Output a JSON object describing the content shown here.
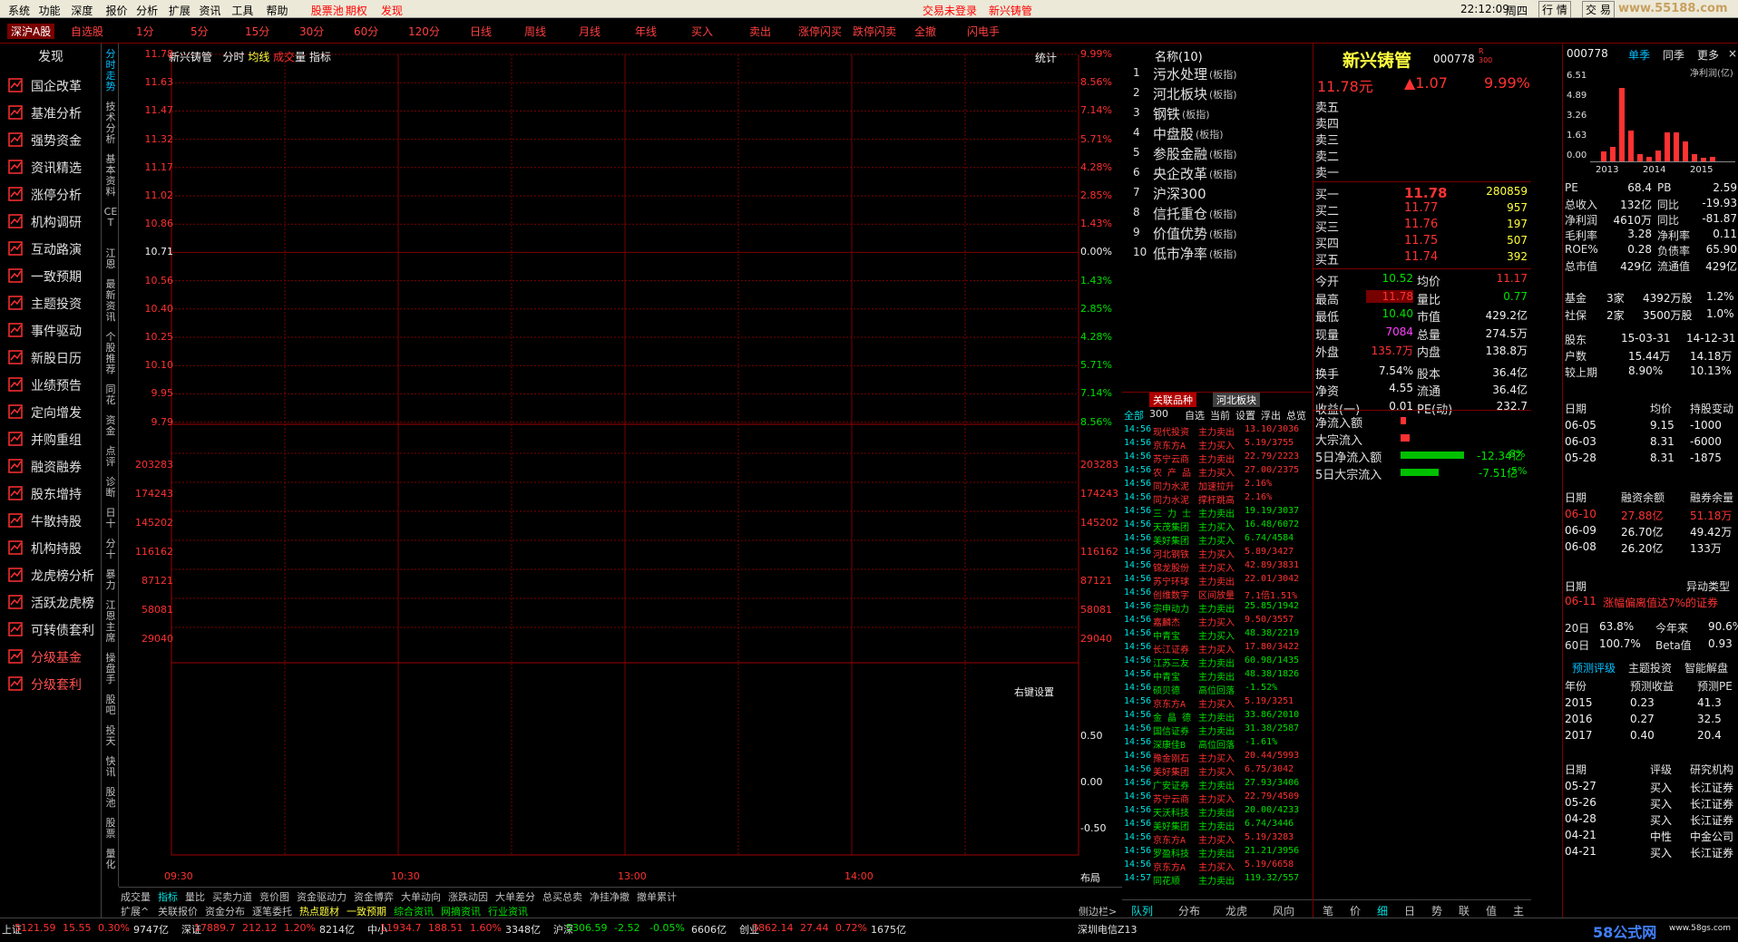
{
  "menu": [
    "系统",
    "功能",
    "深度",
    "报价",
    "分析",
    "扩展",
    "资讯",
    "工具",
    "帮助",
    "股票池",
    "期权",
    "发现"
  ],
  "menu_right": {
    "center": "交易未登录",
    "center2": "新兴铸管",
    "time": "22:12:09",
    "weekday": "周四",
    "trade": "行",
    "hq": "情",
    "trade2": "交",
    "easy": "易",
    "watermark_top": "www.55188.com"
  },
  "tabs": [
    "深沪A股",
    "自选股",
    "1分",
    "5分",
    "15分",
    "30分",
    "60分",
    "120分",
    "日线",
    "周线",
    "月线",
    "年线",
    "买入",
    "卖出",
    "涨停闪买",
    "跌停闪卖",
    "全撤",
    "闪电手"
  ],
  "leftnav": {
    "header": "发现",
    "items": [
      "国企改革",
      "基准分析",
      "强势资金",
      "资讯精选",
      "涨停分析",
      "机构调研",
      "互动路演",
      "一致预期",
      "主题投资",
      "事件驱动",
      "新股日历",
      "业绩预告",
      "定向增发",
      "并购重组",
      "融资融券",
      "股东增持",
      "牛散持股",
      "机构持股",
      "龙虎榜分析",
      "活跃龙虎榜",
      "可转债套利",
      "分级基金",
      "分级套利"
    ]
  },
  "vtabs": [
    "分时走势",
    "技术分析",
    "基本资料",
    "CET",
    "江恩",
    "最新资讯",
    "个股推荐",
    "同花",
    "资金",
    "点评",
    "诊断",
    "日十",
    "分十",
    "暴力",
    "江恩主席",
    "操盘手",
    "股吧",
    "投天",
    "快讯",
    "股池",
    "股票",
    "量化"
  ],
  "chart": {
    "title": "新兴铸管",
    "sub": [
      "分时",
      "均线",
      "成交",
      "量",
      "指标"
    ],
    "stat": "统计",
    "right_setting": "右键设置",
    "ylab_left": [
      "11.78",
      "11.63",
      "11.47",
      "11.32",
      "11.17",
      "11.02",
      "10.86",
      "10.71",
      "10.56",
      "10.40",
      "10.25",
      "10.10",
      "9.95",
      "9.79"
    ],
    "ylab_right": [
      "9.99%",
      "8.56%",
      "7.14%",
      "5.71%",
      "4.28%",
      "2.85%",
      "1.43%",
      "0.00%",
      "1.43%",
      "2.85%",
      "4.28%",
      "5.71%",
      "7.14%",
      "8.56%"
    ],
    "vol_left": [
      "203283",
      "174243",
      "145202",
      "116162",
      "87121",
      "58081",
      "29040"
    ],
    "vol_right": [
      "203283",
      "174243",
      "145202",
      "116162",
      "87121",
      "58081",
      "29040"
    ],
    "ind_right": [
      "0.50",
      "0.00",
      "-0.50"
    ],
    "xlabels": [
      "09:30",
      "10:30",
      "13:00",
      "14:00"
    ],
    "layout": "布局"
  },
  "bottomtabs": {
    "row1": [
      "成交量",
      "指标",
      "量比",
      "买卖力道",
      "竞价图",
      "资金驱动力",
      "资金博弈",
      "大单动向",
      "涨跌动因",
      "大单差分",
      "总买总卖",
      "净挂净撤",
      "撤单累计"
    ],
    "row2": [
      "扩展^",
      "关联报价",
      "资金分布",
      "逐笔委托",
      "热点题材",
      "一致预期",
      "综合资讯",
      "网摘资讯",
      "行业资讯"
    ],
    "side": "侧边栏>"
  },
  "hot": {
    "header": "名称(10)",
    "items": [
      {
        "n": "1",
        "t": "污水处理",
        "s": "(板指)"
      },
      {
        "n": "2",
        "t": "河北板块",
        "s": "(板指)"
      },
      {
        "n": "3",
        "t": "钢铁",
        "s": "(板指)"
      },
      {
        "n": "4",
        "t": "中盘股",
        "s": "(板指)"
      },
      {
        "n": "5",
        "t": "参股金融",
        "s": "(板指)"
      },
      {
        "n": "6",
        "t": "央企改革",
        "s": "(板指)"
      },
      {
        "n": "7",
        "t": "沪深300",
        "s": ""
      },
      {
        "n": "8",
        "t": "信托重仓",
        "s": "(板指)"
      },
      {
        "n": "9",
        "t": "价值优势",
        "s": "(板指)"
      },
      {
        "n": "10",
        "t": "低市净率",
        "s": "(板指)"
      }
    ]
  },
  "tick_tabs": {
    "a": "关联品种",
    "b": "河北板块",
    "row": [
      "全部",
      "300",
      "自选",
      "当前",
      "设置",
      "浮出",
      "总览"
    ]
  },
  "ticks": [
    [
      "14:56",
      "现代投资",
      "主力卖出",
      "13.10/3036",
      "red"
    ],
    [
      "14:56",
      "京东方A",
      "主力买入",
      "5.19/3755",
      "red"
    ],
    [
      "14:56",
      "苏宁云商",
      "主力卖出",
      "22.79/2223",
      "red"
    ],
    [
      "14:56",
      "农 产 品",
      "主力买入",
      "27.00/2375",
      "red"
    ],
    [
      "14:56",
      "同力水泥",
      "加速拉升",
      "2.16%",
      "red"
    ],
    [
      "14:56",
      "同力水泥",
      "撑杆跳高",
      "2.16%",
      "red"
    ],
    [
      "14:56",
      "三 力 士",
      "主力卖出",
      "19.19/3037",
      "green"
    ],
    [
      "14:56",
      "天茂集团",
      "主力买入",
      "16.48/6072",
      "green"
    ],
    [
      "14:56",
      "美好集团",
      "主力买入",
      "6.74/4584",
      "green"
    ],
    [
      "14:56",
      "河北钢铁",
      "主力买入",
      "5.89/3427",
      "red"
    ],
    [
      "14:56",
      "锦龙股份",
      "主力买入",
      "42.89/3831",
      "red"
    ],
    [
      "14:56",
      "苏宁环球",
      "主力卖出",
      "22.01/3042",
      "red"
    ],
    [
      "14:56",
      "创维数字",
      "区间放量",
      "7.1倍1.51%",
      "red"
    ],
    [
      "14:56",
      "宗申动力",
      "主力卖出",
      "25.85/1942",
      "green"
    ],
    [
      "14:56",
      "嘉麟杰",
      "主力买入",
      "9.50/3557",
      "red"
    ],
    [
      "14:56",
      "中青宝",
      "主力买入",
      "48.38/2219",
      "green"
    ],
    [
      "14:56",
      "长江证券",
      "主力买入",
      "17.80/3422",
      "red"
    ],
    [
      "14:56",
      "江苏三友",
      "主力卖出",
      "60.98/1435",
      "green"
    ],
    [
      "14:56",
      "中青宝",
      "主力卖出",
      "48.38/1826",
      "green"
    ],
    [
      "14:56",
      "硕贝德",
      "高位回落",
      "-1.52%",
      "green"
    ],
    [
      "14:56",
      "京东方A",
      "主力买入",
      "5.19/3251",
      "red"
    ],
    [
      "14:56",
      "金 晶 德",
      "主力卖出",
      "33.86/2010",
      "green"
    ],
    [
      "14:56",
      "国信证券",
      "主力卖出",
      "31.38/2587",
      "green"
    ],
    [
      "14:56",
      "深康佳B",
      "高位回落",
      "-1.61%",
      "green"
    ],
    [
      "14:56",
      "豫金刚石",
      "主力买入",
      "20.44/5993",
      "red"
    ],
    [
      "14:56",
      "美好集团",
      "主力买入",
      "6.75/3042",
      "red"
    ],
    [
      "14:56",
      "广安证券",
      "主力卖出",
      "27.93/3406",
      "green"
    ],
    [
      "14:56",
      "苏宁云商",
      "主力买入",
      "22.79/4509",
      "red"
    ],
    [
      "14:56",
      "天沃科技",
      "主力卖出",
      "20.00/4233",
      "green"
    ],
    [
      "14:56",
      "美好集团",
      "主力卖出",
      "6.74/3446",
      "green"
    ],
    [
      "14:56",
      "京东方A",
      "主力买入",
      "5.19/3283",
      "red"
    ],
    [
      "14:56",
      "罗盈科技",
      "主力卖出",
      "21.21/3956",
      "green"
    ],
    [
      "14:56",
      "京东方A",
      "主力买入",
      "5.19/6658",
      "red"
    ],
    [
      "14:57",
      "同花顺",
      "主力卖出",
      "119.32/557",
      "green"
    ]
  ],
  "tick_bottom": [
    "队列",
    "分布",
    "龙虎",
    "风向"
  ],
  "quote": {
    "name": "新兴铸管",
    "code": "000778",
    "sub": "R",
    "sub2": "300",
    "price": "11.78元",
    "change": "▲1.07",
    "pct": "9.99%",
    "sells": [
      "卖五",
      "卖四",
      "卖三",
      "卖二",
      "卖一"
    ],
    "buys": [
      [
        "买一",
        "11.78",
        "280859"
      ],
      [
        "买二",
        "11.77",
        "957"
      ],
      [
        "买三",
        "11.76",
        "197"
      ],
      [
        "买四",
        "11.75",
        "507"
      ],
      [
        "买五",
        "11.74",
        "392"
      ]
    ],
    "stats": [
      [
        "今开",
        "10.52",
        "均价",
        "11.17"
      ],
      [
        "最高",
        "11.78",
        "量比",
        "0.77"
      ],
      [
        "最低",
        "10.40",
        "市值",
        "429.2亿"
      ],
      [
        "现量",
        "7084",
        "总量",
        "274.5万"
      ],
      [
        "外盘",
        "135.7万",
        "内盘",
        "138.8万"
      ],
      [
        "换手",
        "7.54%",
        "股本",
        "36.4亿"
      ],
      [
        "净资",
        "4.55",
        "流通",
        "36.4亿"
      ],
      [
        "收益(一)",
        "0.01",
        "PE(动)",
        "232.7"
      ]
    ],
    "flow": [
      [
        "净流入额",
        "red"
      ],
      [
        "大宗流入",
        "red"
      ],
      [
        "5日净流入额",
        "-12.34亿",
        "-8%"
      ],
      [
        "5日大宗流入",
        "-7.51亿",
        "-5%"
      ]
    ],
    "bottom": [
      "笔",
      "价",
      "细",
      "日",
      "势",
      "联",
      "值",
      "主"
    ]
  },
  "fund": {
    "code": "000778",
    "tabs": [
      "单季",
      "同季",
      "更多"
    ],
    "close": "×",
    "chart_title": "净利润(亿)",
    "years": [
      "2013",
      "2014",
      "2015"
    ],
    "ylabels": [
      "6.51",
      "4.89",
      "3.26",
      "1.63",
      "0.00"
    ],
    "metrics": [
      [
        "PE",
        "68.4",
        "PB",
        "2.59"
      ],
      [
        "总收入",
        "132亿",
        "同比",
        "-19.93"
      ],
      [
        "净利润",
        "4610万",
        "同比",
        "-81.87"
      ],
      [
        "毛利率",
        "3.28",
        "净利率",
        "0.11"
      ],
      [
        "ROE%",
        "0.28",
        "负债率",
        "65.90"
      ],
      [
        "总市值",
        "429亿",
        "流通值",
        "429亿"
      ]
    ],
    "holders": [
      [
        "基金",
        "3家",
        "4392万股",
        "1.2%"
      ],
      [
        "社保",
        "2家",
        "3500万股",
        "1.0%"
      ]
    ],
    "shareholders": {
      "label": "股东",
      "d1": "15-03-31",
      "d2": "14-12-31",
      "r1": [
        "户数",
        "15.44万",
        "14.18万"
      ],
      "r2": [
        "较上期",
        "8.90%",
        "10.13%"
      ]
    },
    "trade": {
      "head": [
        "日期",
        "均价",
        "持股变动"
      ],
      "rows": [
        [
          "06-05",
          "9.15",
          "-1000"
        ],
        [
          "06-03",
          "8.31",
          "-6000"
        ],
        [
          "05-28",
          "8.31",
          "-1875"
        ]
      ]
    },
    "margin": {
      "head": [
        "日期",
        "融资余额",
        "融券余量"
      ],
      "rows": [
        [
          "06-10",
          "27.88亿",
          "51.18万"
        ],
        [
          "06-09",
          "26.70亿",
          "49.42万"
        ],
        [
          "06-08",
          "26.20亿",
          "133万"
        ]
      ]
    },
    "abnormal": {
      "head": [
        "日期",
        "异动类型"
      ],
      "row": [
        "06-11",
        "涨幅偏离值达7%的证券"
      ]
    },
    "ret": [
      [
        "20日",
        "63.8%",
        "今年来",
        "90.6%"
      ],
      [
        "60日",
        "100.7%",
        "Beta值",
        "0.93"
      ]
    ],
    "forecast_tabs": [
      "预测评级",
      "主题投资",
      "智能解盘"
    ],
    "forecast": {
      "head": [
        "年份",
        "预测收益",
        "预测PE"
      ],
      "rows": [
        [
          "2015",
          "0.23",
          "41.3"
        ],
        [
          "2016",
          "0.27",
          "32.5"
        ],
        [
          "2017",
          "0.40",
          "20.4"
        ]
      ]
    },
    "rating": {
      "head": [
        "日期",
        "评级",
        "研究机构"
      ],
      "rows": [
        [
          "05-27",
          "买入",
          "长江证券"
        ],
        [
          "05-26",
          "买入",
          "长江证券"
        ],
        [
          "04-28",
          "买入",
          "长江证券"
        ],
        [
          "04-21",
          "中性",
          "中金公司"
        ],
        [
          "04-21",
          "买入",
          "长江证券"
        ]
      ]
    }
  },
  "status": {
    "items": [
      [
        "上证",
        "5121.59",
        "15.55",
        "0.30%",
        "9747亿"
      ],
      [
        "深证",
        "17889.7",
        "212.12",
        "1.20%",
        "8214亿"
      ],
      [
        "中小",
        "11934.7",
        "188.51",
        "1.60%",
        "3348亿"
      ],
      [
        "沪深",
        "5306.59",
        "-2.52",
        "-0.05%",
        "6606亿"
      ],
      [
        "创业",
        "3862.14",
        "27.44",
        "0.72%",
        "1675亿"
      ]
    ],
    "carrier": "深圳电信Z13",
    "watermark": "58公式网",
    "watermark_url": "www.58gs.com"
  },
  "colors": {
    "red": "#ff3232",
    "green": "#00e000",
    "yellow": "#ffff40",
    "grid": "#7a0000",
    "bg": "#000000"
  }
}
